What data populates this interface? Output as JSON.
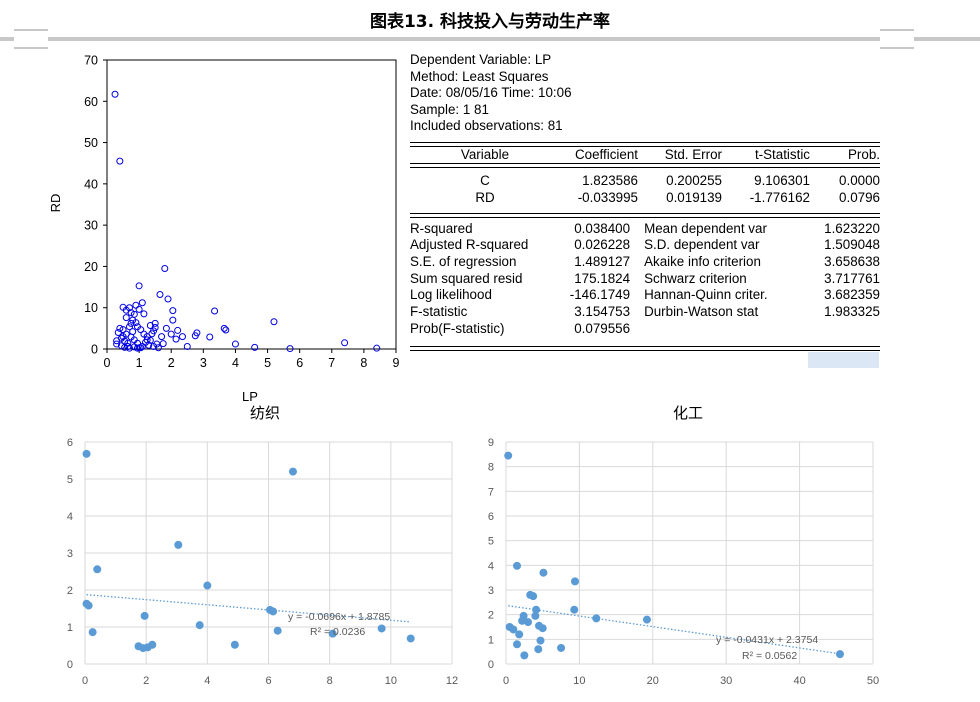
{
  "header": {
    "title": "图表13.  科技投入与劳动生产率"
  },
  "eviews_scatter": {
    "chart_data": {
      "type": "scatter",
      "xlabel": "LP",
      "ylabel": "RD",
      "xlim": [
        0,
        9
      ],
      "ylim": [
        0,
        70
      ],
      "xticks": [
        0,
        1,
        2,
        3,
        4,
        5,
        6,
        7,
        8,
        9
      ],
      "yticks": [
        0,
        10,
        20,
        30,
        40,
        50,
        60,
        70
      ],
      "marker": "hollow circle",
      "color": "#0000e6",
      "points": [
        [
          0.25,
          61.7
        ],
        [
          0.4,
          45.5
        ],
        [
          1.0,
          15.3
        ],
        [
          1.8,
          19.5
        ],
        [
          1.9,
          12.1
        ],
        [
          1.65,
          13.2
        ],
        [
          5.2,
          6.6
        ],
        [
          3.35,
          9.2
        ],
        [
          2.05,
          9.3
        ],
        [
          7.4,
          1.5
        ],
        [
          8.4,
          0.2
        ],
        [
          5.7,
          0.1
        ],
        [
          4.6,
          0.4
        ],
        [
          4.0,
          1.2
        ],
        [
          3.7,
          4.6
        ],
        [
          3.65,
          5.0
        ],
        [
          2.75,
          3.2
        ],
        [
          2.8,
          3.9
        ],
        [
          3.2,
          2.9
        ],
        [
          2.5,
          0.6
        ],
        [
          2.15,
          2.4
        ],
        [
          2.2,
          4.5
        ],
        [
          2.0,
          3.6
        ],
        [
          1.85,
          5.0
        ],
        [
          2.05,
          7.0
        ],
        [
          1.5,
          6.2
        ],
        [
          1.5,
          5.2
        ],
        [
          1.45,
          4.4
        ],
        [
          1.35,
          5.7
        ],
        [
          1.25,
          3.0
        ],
        [
          1.35,
          2.1
        ],
        [
          1.2,
          1.6
        ],
        [
          1.6,
          0.3
        ],
        [
          1.1,
          0.6
        ],
        [
          1.0,
          0.3
        ],
        [
          0.85,
          0.5
        ],
        [
          0.7,
          0.2
        ],
        [
          0.55,
          0.4
        ],
        [
          0.3,
          1.2
        ],
        [
          0.3,
          2.0
        ],
        [
          0.35,
          4.0
        ],
        [
          0.5,
          4.7
        ],
        [
          0.6,
          3.6
        ],
        [
          0.45,
          2.6
        ],
        [
          0.8,
          4.2
        ],
        [
          0.7,
          5.4
        ],
        [
          0.9,
          6.4
        ],
        [
          0.6,
          7.6
        ],
        [
          0.6,
          9.4
        ],
        [
          0.7,
          10.0
        ],
        [
          0.5,
          10.1
        ],
        [
          0.85,
          8.4
        ],
        [
          1.0,
          9.6
        ],
        [
          1.1,
          11.2
        ],
        [
          0.9,
          10.6
        ],
        [
          0.75,
          6.2
        ],
        [
          0.95,
          5.4
        ],
        [
          1.05,
          4.7
        ],
        [
          1.15,
          3.6
        ],
        [
          0.85,
          2.2
        ],
        [
          0.65,
          1.4
        ],
        [
          0.45,
          0.8
        ],
        [
          0.55,
          1.9
        ],
        [
          0.95,
          1.4
        ],
        [
          0.75,
          2.9
        ],
        [
          1.3,
          0.9
        ],
        [
          1.55,
          1.2
        ],
        [
          1.4,
          3.7
        ],
        [
          1.7,
          3.0
        ],
        [
          1.75,
          1.3
        ],
        [
          2.35,
          3.0
        ],
        [
          1.15,
          8.5
        ],
        [
          0.5,
          3.0
        ],
        [
          0.95,
          0.2
        ],
        [
          1.25,
          2.2
        ],
        [
          0.65,
          0.6
        ],
        [
          0.8,
          7.0
        ],
        [
          1.05,
          0.3
        ],
        [
          0.4,
          5.0
        ],
        [
          0.75,
          8.8
        ],
        [
          1.45,
          0.6
        ]
      ]
    }
  },
  "regression": {
    "header_lines": [
      "Dependent Variable: LP",
      "Method: Least Squares",
      "Date: 08/05/16   Time: 10:06",
      "Sample: 1 81",
      "Included observations: 81"
    ],
    "columns": [
      "Variable",
      "Coefficient",
      "Std. Error",
      "t-Statistic",
      "Prob."
    ],
    "rows": [
      [
        "C",
        "1.823586",
        "0.200255",
        "9.106301",
        "0.0000"
      ],
      [
        "RD",
        "-0.033995",
        "0.019139",
        "-1.776162",
        "0.0796"
      ]
    ],
    "stats": [
      [
        "R-squared",
        "0.038400",
        "Mean dependent var",
        "1.623220"
      ],
      [
        "Adjusted R-squared",
        "0.026228",
        "S.D. dependent var",
        "1.509048"
      ],
      [
        "S.E. of regression",
        "1.489127",
        "Akaike info criterion",
        "3.658638"
      ],
      [
        "Sum squared resid",
        "175.1824",
        "Schwarz criterion",
        "3.717761"
      ],
      [
        "Log likelihood",
        "-146.1749",
        "Hannan-Quinn criter.",
        "3.682359"
      ],
      [
        "F-statistic",
        "3.154753",
        "Durbin-Watson stat",
        "1.983325"
      ],
      [
        "Prob(F-statistic)",
        "0.079556",
        "",
        ""
      ]
    ]
  },
  "textile_chart": {
    "chart_data": {
      "type": "scatter",
      "title": "纺织",
      "xlim": [
        0,
        12
      ],
      "ylim": [
        0,
        6
      ],
      "xticks": [
        0,
        2,
        4,
        6,
        8,
        10,
        12
      ],
      "yticks": [
        0,
        1,
        2,
        3,
        4,
        5,
        6
      ],
      "marker": "filled circle",
      "color": "#5b9bd5",
      "grid": true,
      "trendline": {
        "slope": -0.0696,
        "intercept": 1.8785,
        "style": "dotted",
        "equation": "y = -0.0696x + 1.8785",
        "r2": "R² = 0.0236"
      },
      "points": [
        [
          0.05,
          5.68
        ],
        [
          0.05,
          1.63
        ],
        [
          0.12,
          1.58
        ],
        [
          0.25,
          0.86
        ],
        [
          0.4,
          2.56
        ],
        [
          1.75,
          0.48
        ],
        [
          1.9,
          0.43
        ],
        [
          2.05,
          0.45
        ],
        [
          1.95,
          1.3
        ],
        [
          2.2,
          0.52
        ],
        [
          3.05,
          3.22
        ],
        [
          3.75,
          1.05
        ],
        [
          4.0,
          2.12
        ],
        [
          4.9,
          0.52
        ],
        [
          6.05,
          1.46
        ],
        [
          6.15,
          1.42
        ],
        [
          6.3,
          0.9
        ],
        [
          6.8,
          5.2
        ],
        [
          8.1,
          0.82
        ],
        [
          9.7,
          0.96
        ],
        [
          10.65,
          0.69
        ]
      ]
    }
  },
  "chemical_chart": {
    "chart_data": {
      "type": "scatter",
      "title": "化工",
      "xlim": [
        0,
        50
      ],
      "ylim": [
        0,
        9
      ],
      "xticks": [
        0,
        10,
        20,
        30,
        40,
        50
      ],
      "yticks": [
        0,
        1,
        2,
        3,
        4,
        5,
        6,
        7,
        8,
        9
      ],
      "marker": "filled circle",
      "color": "#5b9bd5",
      "grid": true,
      "trendline": {
        "slope": -0.0431,
        "intercept": 2.3754,
        "style": "dotted",
        "equation": "y = -0.0431x + 2.3754",
        "r2": "R² = 0.0562"
      },
      "points": [
        [
          0.3,
          8.45
        ],
        [
          0.5,
          1.5
        ],
        [
          1.0,
          1.4
        ],
        [
          1.5,
          0.8
        ],
        [
          1.8,
          1.2
        ],
        [
          1.5,
          3.98
        ],
        [
          2.2,
          1.75
        ],
        [
          2.4,
          1.95
        ],
        [
          2.5,
          0.35
        ],
        [
          3.0,
          1.7
        ],
        [
          3.3,
          2.8
        ],
        [
          3.7,
          2.75
        ],
        [
          4.0,
          1.95
        ],
        [
          4.1,
          2.2
        ],
        [
          4.5,
          1.55
        ],
        [
          4.7,
          0.95
        ],
        [
          4.4,
          0.6
        ],
        [
          5.0,
          1.45
        ],
        [
          5.1,
          3.7
        ],
        [
          7.5,
          0.65
        ],
        [
          9.3,
          2.2
        ],
        [
          9.4,
          3.35
        ],
        [
          12.3,
          1.85
        ],
        [
          19.2,
          1.8
        ],
        [
          45.5,
          0.4
        ]
      ]
    }
  }
}
